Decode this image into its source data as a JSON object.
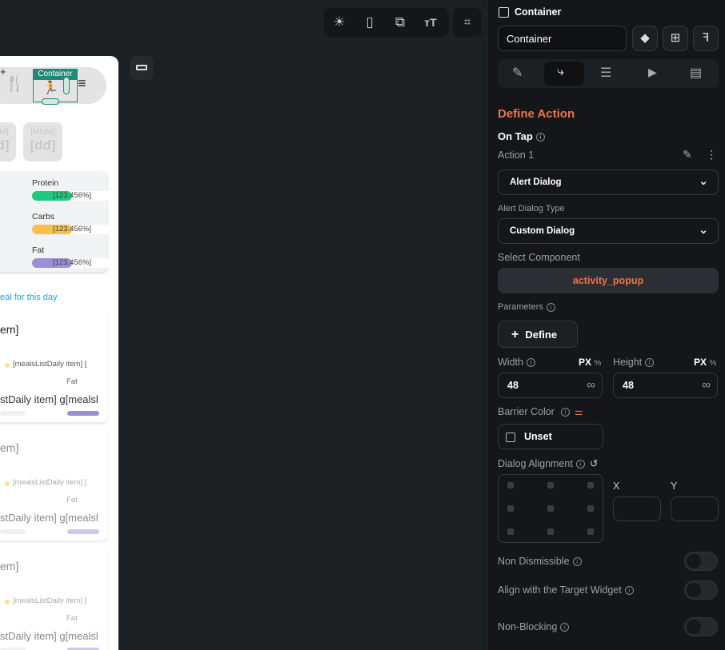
{
  "canvas": {
    "toolbar": {
      "icons": [
        "sun-icon",
        "phone-icon",
        "tablet-icon",
        "text-size-icon",
        "tree-settings-icon"
      ]
    },
    "selected_label": "Container",
    "dates": [
      {
        "month": "[MMM]",
        "day": "[dd]"
      },
      {
        "month": "[MMM]",
        "day": "[dd]"
      }
    ],
    "macros": [
      {
        "name": "Protein",
        "value": "[123.456%]",
        "color": "#1ecb7e",
        "fill": 0.5
      },
      {
        "name": "Carbs",
        "value": "[123.456%]",
        "color": "#f7c04a",
        "fill": 0.5
      },
      {
        "name": "Fat",
        "value": "[123.456%]",
        "color": "#9b8fd6",
        "fill": 0.5
      }
    ],
    "add_meal_link": "eal for this day",
    "meals": [
      {
        "title": "em]",
        "small": "[mealsListDaily item] [",
        "fat": "Fat",
        "big": "stDaily item] g[mealsl"
      },
      {
        "title": "em]",
        "small": "[mealsListDaily item] [",
        "fat": "Fat",
        "big": "stDaily item] g[mealsl"
      },
      {
        "title": "em]",
        "small": "[mealsListDaily item] [",
        "fat": "Fat",
        "big": "stDaily item] g[mealsl"
      }
    ]
  },
  "panel": {
    "widget_type": "Container",
    "widget_name": "Container",
    "tabs": [
      "properties-icon",
      "actions-icon",
      "backend-query-icon",
      "animations-icon",
      "notes-icon"
    ],
    "active_tab": 1,
    "section_title": "Define Action",
    "trigger": "On Tap",
    "action_label": "Action 1",
    "action_type": "Alert Dialog",
    "dialog_type_label": "Alert Dialog Type",
    "dialog_type": "Custom Dialog",
    "select_component_label": "Select Component",
    "component": "activity_popup",
    "parameters_label": "Parameters",
    "define_button": "Define",
    "width_label": "Width",
    "height_label": "Height",
    "unit_px": "PX",
    "unit_pct": "%",
    "width_value": "48",
    "height_value": "48",
    "infinity": "∞",
    "barrier_color_label": "Barrier Color",
    "barrier_value": "Unset",
    "alignment_label": "Dialog Alignment",
    "x_label": "X",
    "y_label": "Y",
    "non_dismissible": "Non Dismissible",
    "align_target": "Align with the Target Widget",
    "non_blocking": "Non-Blocking",
    "accent": "#e8764a"
  }
}
